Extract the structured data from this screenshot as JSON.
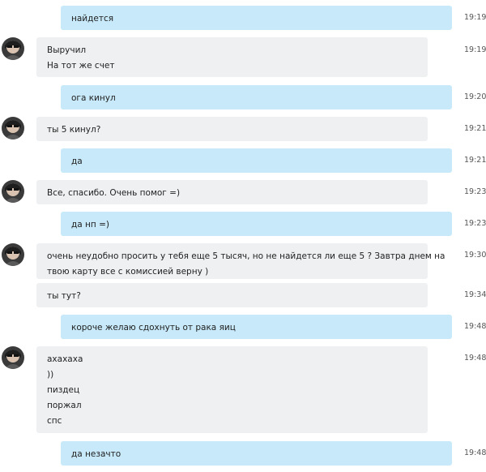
{
  "messages": [
    {
      "direction": "out",
      "lines": [
        "найдется"
      ],
      "time": "19:19"
    },
    {
      "direction": "in",
      "avatar": true,
      "lines": [
        "Выручил",
        "На тот же счет"
      ],
      "time": "19:19"
    },
    {
      "direction": "out",
      "lines": [
        "ога кинул"
      ],
      "time": "19:20"
    },
    {
      "direction": "in",
      "avatar": true,
      "lines": [
        "ты 5 кинул?"
      ],
      "time": "19:21"
    },
    {
      "direction": "out",
      "lines": [
        "да"
      ],
      "time": "19:21"
    },
    {
      "direction": "in",
      "avatar": true,
      "lines": [
        "Все, спасибо. Очень помог =)"
      ],
      "time": "19:23"
    },
    {
      "direction": "out",
      "lines": [
        "да нп =)"
      ],
      "time": "19:23"
    },
    {
      "direction": "in",
      "avatar": true,
      "lines": [
        "очень неудобно просить у тебя еще 5 тысяч, но не найдется ли еще 5 ? Завтра днем на",
        "твою карту все с комиссией верну )"
      ],
      "time": "19:30"
    },
    {
      "direction": "in",
      "avatar": false,
      "lines": [
        "ты тут?"
      ],
      "time": "19:34"
    },
    {
      "direction": "out",
      "lines": [
        "короче желаю сдохнуть от рака яиц"
      ],
      "time": "19:48"
    },
    {
      "direction": "in",
      "avatar": true,
      "lines": [
        "ахахаха",
        "))",
        "пиздец",
        "поржал",
        "спс"
      ],
      "time": "19:48"
    },
    {
      "direction": "out",
      "lines": [
        "да незачто"
      ],
      "time": "19:48"
    }
  ],
  "colors": {
    "outgoing_bubble": "#c7e9f9",
    "incoming_bubble": "#eef0f2",
    "timestamp": "#555555"
  },
  "icons": {
    "avatar": "contact-avatar-icon"
  }
}
